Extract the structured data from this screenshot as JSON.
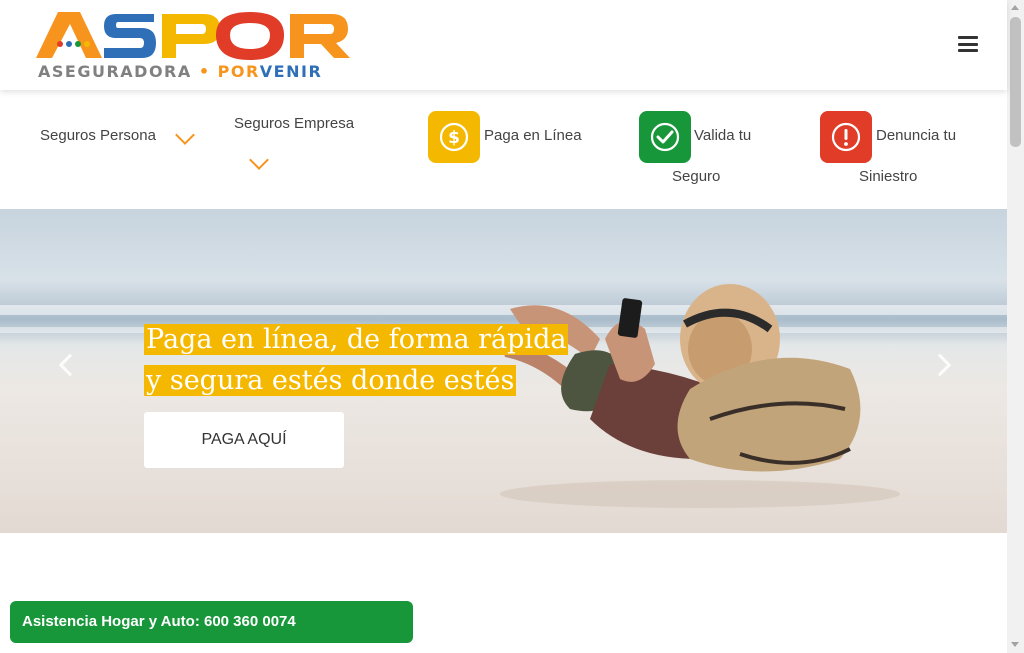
{
  "header": {
    "logo_text": "ASPOR",
    "logo_sub_grey": "ASEGURADORA",
    "logo_sub_dot": "•",
    "logo_sub_orange": "POR",
    "logo_sub_blue": "VENIR"
  },
  "nav": {
    "seguros_persona": "Seguros Persona",
    "seguros_empresa": "Seguros Empresa",
    "paga_en_linea": "Paga en Línea",
    "valida_line1": "Valida tu",
    "valida_line2": "Seguro",
    "denuncia_line1": "Denuncia tu",
    "denuncia_line2": "Siniestro"
  },
  "hero": {
    "title_line1": "Paga en línea, de forma rápida",
    "title_line2": "y segura estés donde estés",
    "button_label": "PAGA AQUÍ"
  },
  "assist": {
    "label": "Asistencia Hogar y Auto: 600 360 0074"
  },
  "colors": {
    "brand_orange": "#f7941d",
    "brand_blue": "#2e6fb7",
    "pay_yellow": "#f5b800",
    "validate_green": "#17973a",
    "report_red": "#e03c27"
  },
  "icons": {
    "pay": "dollar-circle-icon",
    "validate": "check-circle-icon",
    "report": "exclamation-circle-icon",
    "menu": "hamburger-menu-icon"
  }
}
